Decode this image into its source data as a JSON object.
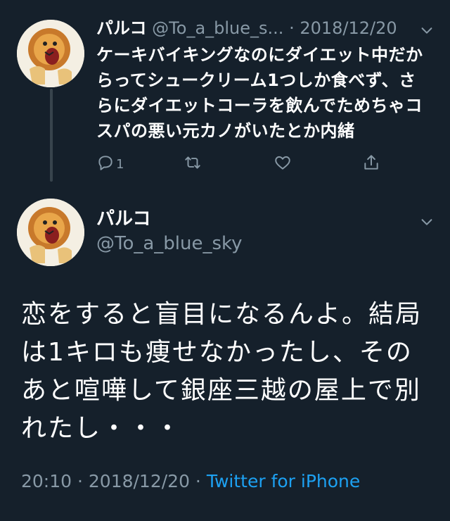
{
  "reply": {
    "name": "パルコ",
    "handle": "@To_a_blue_s...",
    "separator": " · ",
    "date": "2018/12/20",
    "text": "ケーキバイキングなのにダイエット中だからってシュークリーム1つしか食べず、さらにダイエットコーラを飲んでためちゃコスパの悪い元カノがいたとか内緒",
    "reply_count": "1",
    "icons": [
      "reply-icon",
      "retweet-icon",
      "like-icon",
      "share-icon"
    ]
  },
  "main": {
    "name": "パルコ",
    "handle": "@To_a_blue_sky",
    "text": "恋をすると盲目になるんよ。結局は1キロも痩せなかったし、そのあと喧嘩して銀座三越の屋上で別れたし・・・",
    "time": "20:10 · 2018/12/20 · ",
    "source": "Twitter for iPhone"
  },
  "colors": {
    "background": "#15202b",
    "secondary_text": "#8899a6",
    "link": "#1da1f2",
    "thread_line": "#38444d"
  }
}
